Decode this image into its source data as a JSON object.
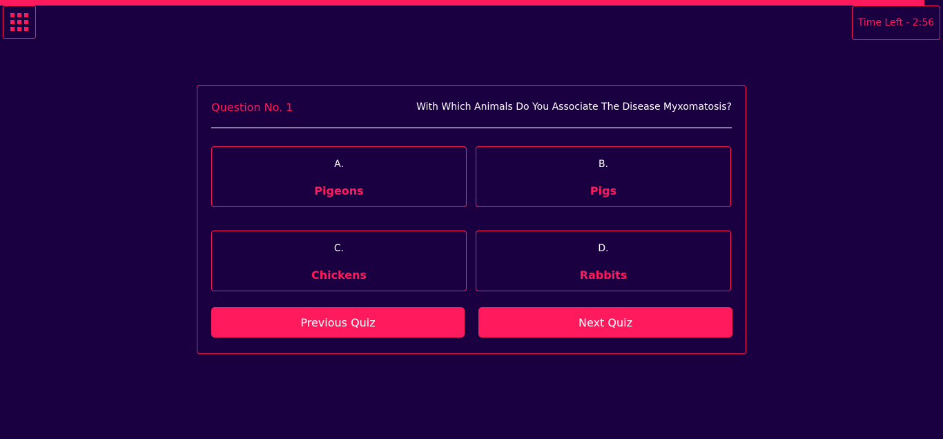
{
  "progress": {
    "fraction": 0.98,
    "color": "#ff1a5e"
  },
  "menu": {
    "icon": "grid-icon"
  },
  "timer": {
    "label": "Time Left - 2:56"
  },
  "question": {
    "number_label": "Question No. 1",
    "text": "With Which Animals Do You Associate The Disease Myxomatosis?"
  },
  "options": [
    {
      "letter": "A.",
      "text": "Pigeons"
    },
    {
      "letter": "B.",
      "text": "Pigs"
    },
    {
      "letter": "C.",
      "text": "Chickens"
    },
    {
      "letter": "D.",
      "text": "Rabbits"
    }
  ],
  "buttons": {
    "previous": "Previous Quiz",
    "next": "Next Quiz"
  },
  "colors": {
    "background": "#1a0040",
    "accent": "#ff1a5e",
    "text": "#ffffff"
  }
}
